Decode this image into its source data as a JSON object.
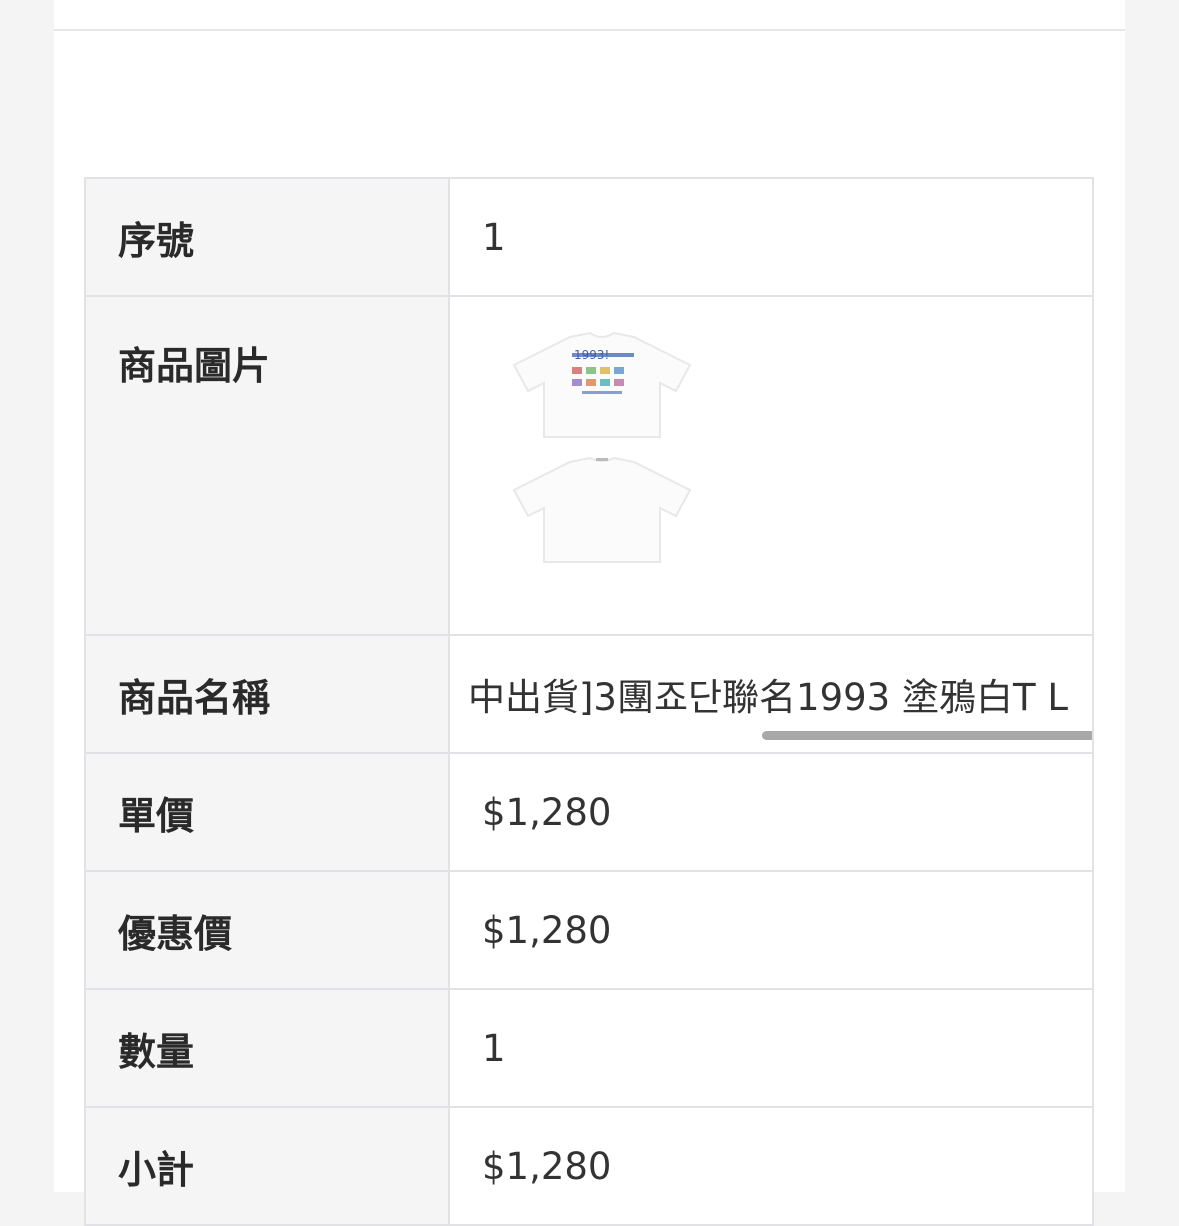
{
  "order_item": {
    "rows": {
      "index": {
        "label": "序號",
        "value": "1"
      },
      "image": {
        "label": "商品圖片",
        "alt_front": "t-shirt-front",
        "alt_back": "t-shirt-back"
      },
      "name": {
        "label": "商品名稱",
        "value": "中出貨]3團죠단聯名1993 塗鴉白T L"
      },
      "unit_price": {
        "label": "單價",
        "value": "$1,280"
      },
      "sale_price": {
        "label": "優惠價",
        "value": "$1,280"
      },
      "quantity": {
        "label": "數量",
        "value": "1"
      },
      "subtotal": {
        "label": "小計",
        "value": "$1,280"
      }
    }
  },
  "colors": {
    "label_bg": "#f5f5f6",
    "border": "#e1e1e6",
    "page_bg": "#f4f4f5",
    "text": "#333333"
  }
}
